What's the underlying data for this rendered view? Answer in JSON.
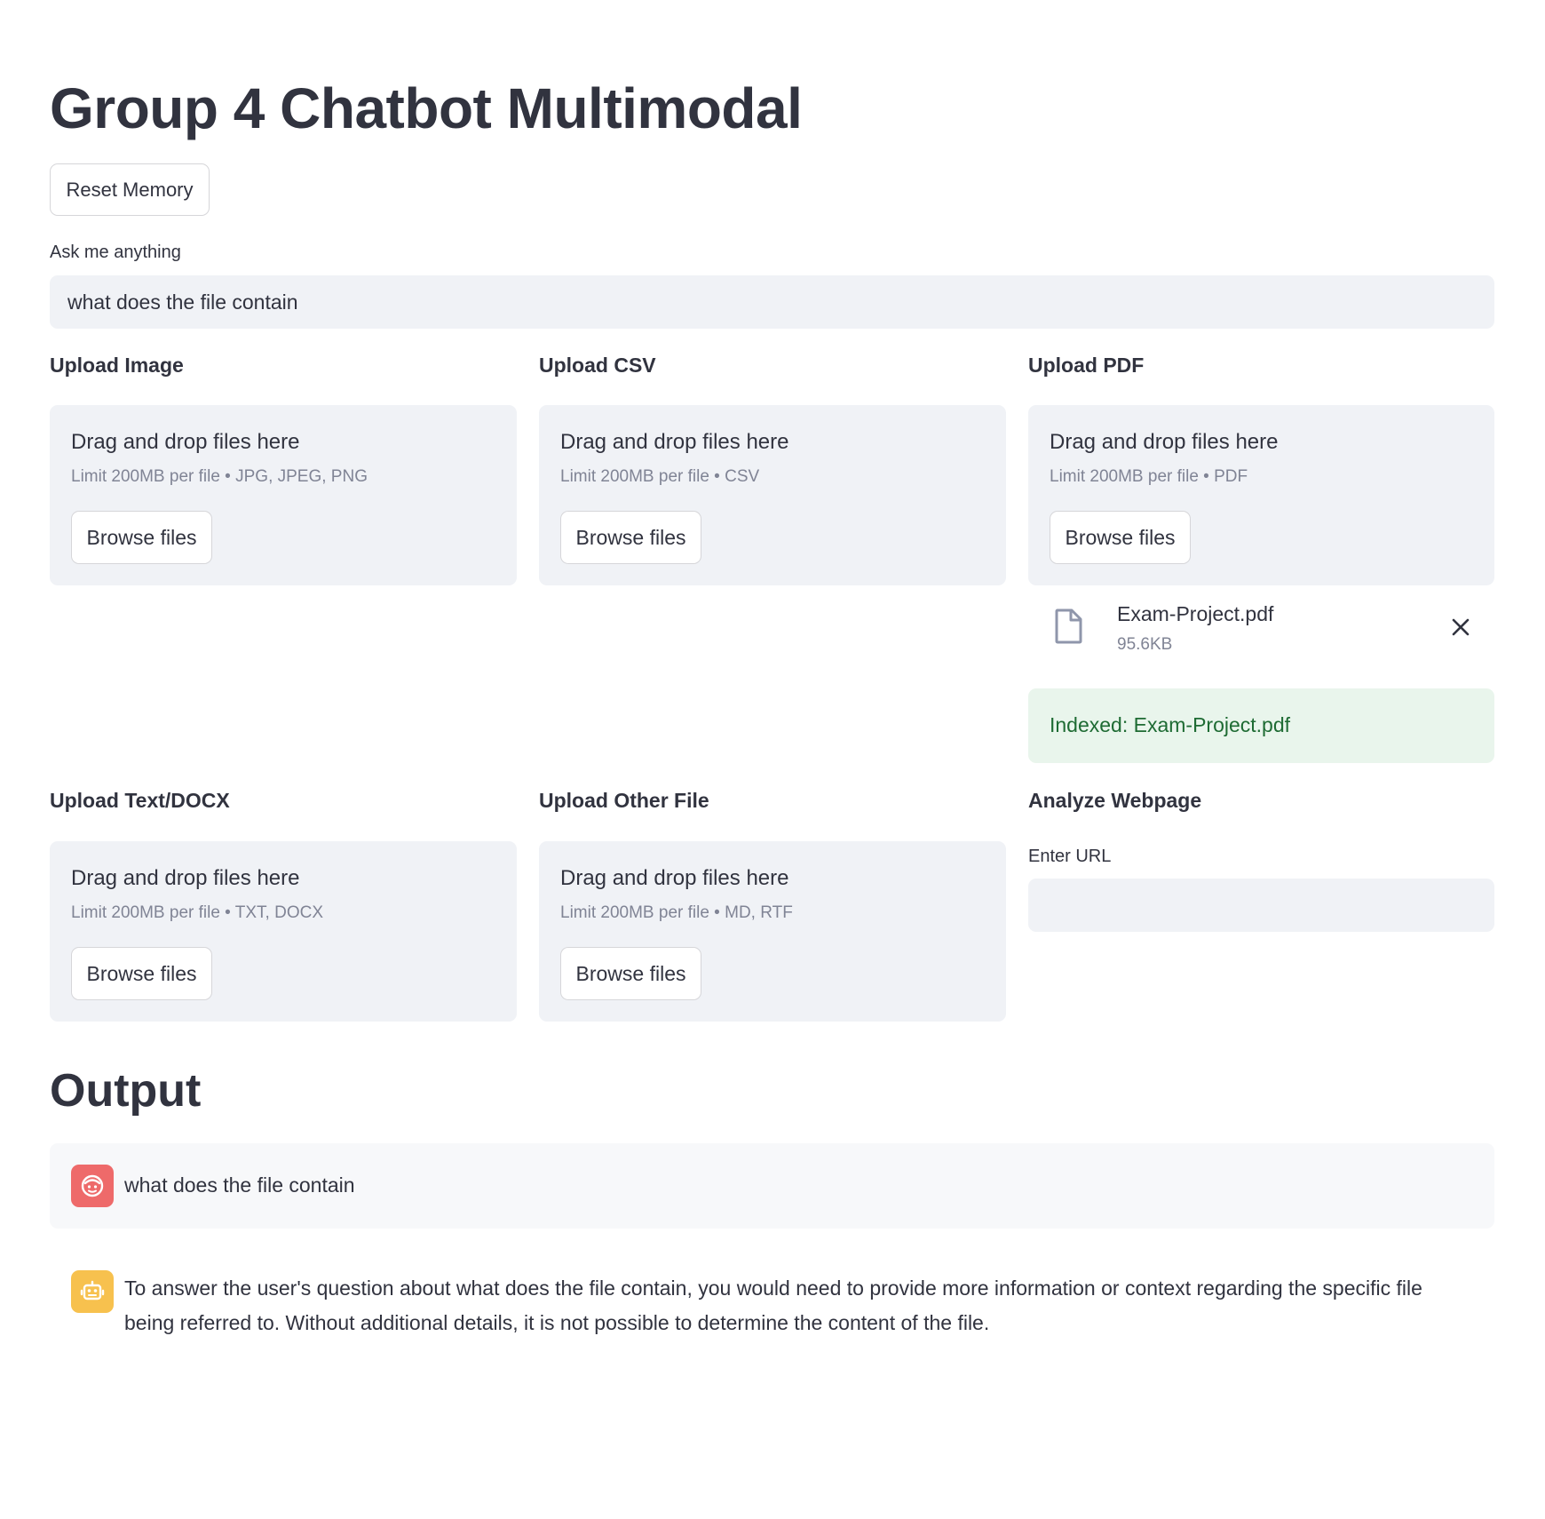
{
  "app": {
    "title": "Group 4 Chatbot Multimodal",
    "reset_label": "Reset Memory"
  },
  "query": {
    "label": "Ask me anything",
    "value": "what does the file contain"
  },
  "uploaders": [
    {
      "heading": "Upload Image",
      "dz_title": "Drag and drop files here",
      "limit": "Limit 200MB per file • JPG, JPEG, PNG",
      "browse": "Browse files"
    },
    {
      "heading": "Upload CSV",
      "dz_title": "Drag and drop files here",
      "limit": "Limit 200MB per file • CSV",
      "browse": "Browse files"
    },
    {
      "heading": "Upload PDF",
      "dz_title": "Drag and drop files here",
      "limit": "Limit 200MB per file • PDF",
      "browse": "Browse files"
    },
    {
      "heading": "Upload Text/DOCX",
      "dz_title": "Drag and drop files here",
      "limit": "Limit 200MB per file • TXT, DOCX",
      "browse": "Browse files"
    },
    {
      "heading": "Upload Other File",
      "dz_title": "Drag and drop files here",
      "limit": "Limit 200MB per file • MD, RTF",
      "browse": "Browse files"
    }
  ],
  "uploaded_file": {
    "name": "Exam-Project.pdf",
    "size": "95.6KB",
    "icon": "file-icon",
    "remove_icon": "close-icon"
  },
  "status": {
    "message": "Indexed: Exam-Project.pdf",
    "color": "#1e6b33",
    "background": "#e9f5ec"
  },
  "webpage": {
    "heading": "Analyze Webpage",
    "url_label": "Enter URL",
    "url_value": ""
  },
  "output": {
    "heading": "Output",
    "messages": [
      {
        "role": "user",
        "avatar_icon": "user-face-icon",
        "avatar_color": "#ee6a6a",
        "text": "what does the file contain"
      },
      {
        "role": "assistant",
        "avatar_icon": "robot-icon",
        "avatar_color": "#f7c14e",
        "text": "To answer the user's question about what does the file contain, you would need to provide more information or context regarding the specific file being referred to. Without additional details, it is not possible to determine the content of the file."
      }
    ]
  }
}
